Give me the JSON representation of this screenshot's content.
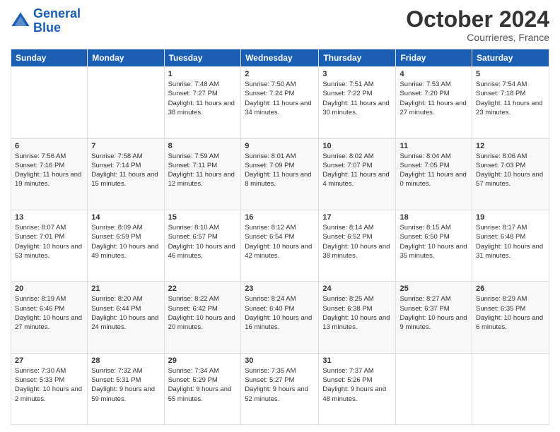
{
  "header": {
    "logo_line1": "General",
    "logo_line2": "Blue",
    "month": "October 2024",
    "location": "Courrieres, France"
  },
  "weekdays": [
    "Sunday",
    "Monday",
    "Tuesday",
    "Wednesday",
    "Thursday",
    "Friday",
    "Saturday"
  ],
  "weeks": [
    [
      {
        "day": "",
        "sunrise": "",
        "sunset": "",
        "daylight": ""
      },
      {
        "day": "",
        "sunrise": "",
        "sunset": "",
        "daylight": ""
      },
      {
        "day": "1",
        "sunrise": "Sunrise: 7:48 AM",
        "sunset": "Sunset: 7:27 PM",
        "daylight": "Daylight: 11 hours and 38 minutes."
      },
      {
        "day": "2",
        "sunrise": "Sunrise: 7:50 AM",
        "sunset": "Sunset: 7:24 PM",
        "daylight": "Daylight: 11 hours and 34 minutes."
      },
      {
        "day": "3",
        "sunrise": "Sunrise: 7:51 AM",
        "sunset": "Sunset: 7:22 PM",
        "daylight": "Daylight: 11 hours and 30 minutes."
      },
      {
        "day": "4",
        "sunrise": "Sunrise: 7:53 AM",
        "sunset": "Sunset: 7:20 PM",
        "daylight": "Daylight: 11 hours and 27 minutes."
      },
      {
        "day": "5",
        "sunrise": "Sunrise: 7:54 AM",
        "sunset": "Sunset: 7:18 PM",
        "daylight": "Daylight: 11 hours and 23 minutes."
      }
    ],
    [
      {
        "day": "6",
        "sunrise": "Sunrise: 7:56 AM",
        "sunset": "Sunset: 7:16 PM",
        "daylight": "Daylight: 11 hours and 19 minutes."
      },
      {
        "day": "7",
        "sunrise": "Sunrise: 7:58 AM",
        "sunset": "Sunset: 7:14 PM",
        "daylight": "Daylight: 11 hours and 15 minutes."
      },
      {
        "day": "8",
        "sunrise": "Sunrise: 7:59 AM",
        "sunset": "Sunset: 7:11 PM",
        "daylight": "Daylight: 11 hours and 12 minutes."
      },
      {
        "day": "9",
        "sunrise": "Sunrise: 8:01 AM",
        "sunset": "Sunset: 7:09 PM",
        "daylight": "Daylight: 11 hours and 8 minutes."
      },
      {
        "day": "10",
        "sunrise": "Sunrise: 8:02 AM",
        "sunset": "Sunset: 7:07 PM",
        "daylight": "Daylight: 11 hours and 4 minutes."
      },
      {
        "day": "11",
        "sunrise": "Sunrise: 8:04 AM",
        "sunset": "Sunset: 7:05 PM",
        "daylight": "Daylight: 11 hours and 0 minutes."
      },
      {
        "day": "12",
        "sunrise": "Sunrise: 8:06 AM",
        "sunset": "Sunset: 7:03 PM",
        "daylight": "Daylight: 10 hours and 57 minutes."
      }
    ],
    [
      {
        "day": "13",
        "sunrise": "Sunrise: 8:07 AM",
        "sunset": "Sunset: 7:01 PM",
        "daylight": "Daylight: 10 hours and 53 minutes."
      },
      {
        "day": "14",
        "sunrise": "Sunrise: 8:09 AM",
        "sunset": "Sunset: 6:59 PM",
        "daylight": "Daylight: 10 hours and 49 minutes."
      },
      {
        "day": "15",
        "sunrise": "Sunrise: 8:10 AM",
        "sunset": "Sunset: 6:57 PM",
        "daylight": "Daylight: 10 hours and 46 minutes."
      },
      {
        "day": "16",
        "sunrise": "Sunrise: 8:12 AM",
        "sunset": "Sunset: 6:54 PM",
        "daylight": "Daylight: 10 hours and 42 minutes."
      },
      {
        "day": "17",
        "sunrise": "Sunrise: 8:14 AM",
        "sunset": "Sunset: 6:52 PM",
        "daylight": "Daylight: 10 hours and 38 minutes."
      },
      {
        "day": "18",
        "sunrise": "Sunrise: 8:15 AM",
        "sunset": "Sunset: 6:50 PM",
        "daylight": "Daylight: 10 hours and 35 minutes."
      },
      {
        "day": "19",
        "sunrise": "Sunrise: 8:17 AM",
        "sunset": "Sunset: 6:48 PM",
        "daylight": "Daylight: 10 hours and 31 minutes."
      }
    ],
    [
      {
        "day": "20",
        "sunrise": "Sunrise: 8:19 AM",
        "sunset": "Sunset: 6:46 PM",
        "daylight": "Daylight: 10 hours and 27 minutes."
      },
      {
        "day": "21",
        "sunrise": "Sunrise: 8:20 AM",
        "sunset": "Sunset: 6:44 PM",
        "daylight": "Daylight: 10 hours and 24 minutes."
      },
      {
        "day": "22",
        "sunrise": "Sunrise: 8:22 AM",
        "sunset": "Sunset: 6:42 PM",
        "daylight": "Daylight: 10 hours and 20 minutes."
      },
      {
        "day": "23",
        "sunrise": "Sunrise: 8:24 AM",
        "sunset": "Sunset: 6:40 PM",
        "daylight": "Daylight: 10 hours and 16 minutes."
      },
      {
        "day": "24",
        "sunrise": "Sunrise: 8:25 AM",
        "sunset": "Sunset: 6:38 PM",
        "daylight": "Daylight: 10 hours and 13 minutes."
      },
      {
        "day": "25",
        "sunrise": "Sunrise: 8:27 AM",
        "sunset": "Sunset: 6:37 PM",
        "daylight": "Daylight: 10 hours and 9 minutes."
      },
      {
        "day": "26",
        "sunrise": "Sunrise: 8:29 AM",
        "sunset": "Sunset: 6:35 PM",
        "daylight": "Daylight: 10 hours and 6 minutes."
      }
    ],
    [
      {
        "day": "27",
        "sunrise": "Sunrise: 7:30 AM",
        "sunset": "Sunset: 5:33 PM",
        "daylight": "Daylight: 10 hours and 2 minutes."
      },
      {
        "day": "28",
        "sunrise": "Sunrise: 7:32 AM",
        "sunset": "Sunset: 5:31 PM",
        "daylight": "Daylight: 9 hours and 59 minutes."
      },
      {
        "day": "29",
        "sunrise": "Sunrise: 7:34 AM",
        "sunset": "Sunset: 5:29 PM",
        "daylight": "Daylight: 9 hours and 55 minutes."
      },
      {
        "day": "30",
        "sunrise": "Sunrise: 7:35 AM",
        "sunset": "Sunset: 5:27 PM",
        "daylight": "Daylight: 9 hours and 52 minutes."
      },
      {
        "day": "31",
        "sunrise": "Sunrise: 7:37 AM",
        "sunset": "Sunset: 5:26 PM",
        "daylight": "Daylight: 9 hours and 48 minutes."
      },
      {
        "day": "",
        "sunrise": "",
        "sunset": "",
        "daylight": ""
      },
      {
        "day": "",
        "sunrise": "",
        "sunset": "",
        "daylight": ""
      }
    ]
  ]
}
